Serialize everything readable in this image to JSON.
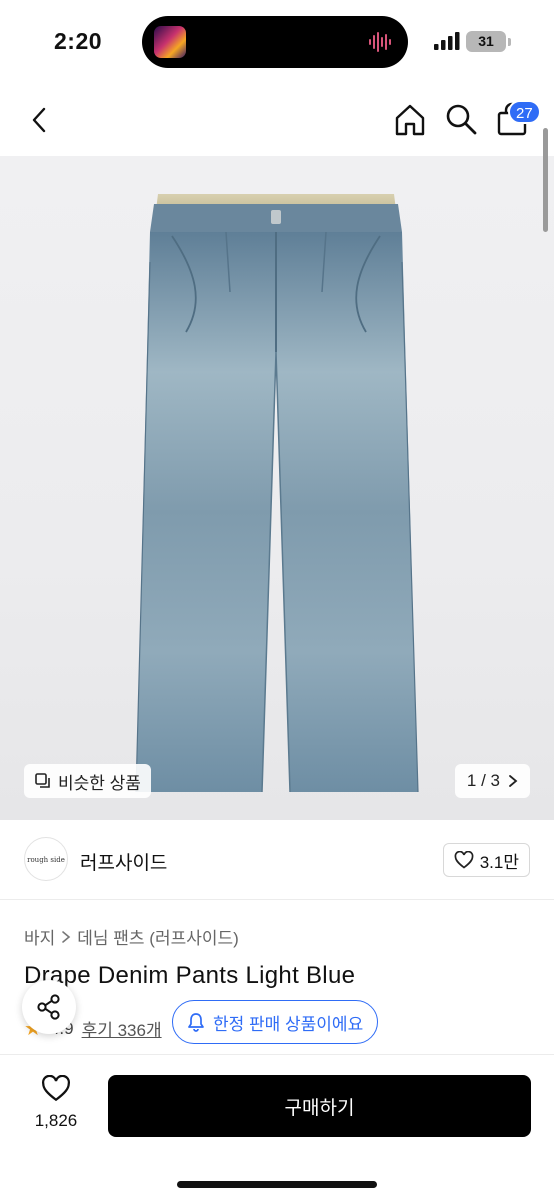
{
  "status_bar": {
    "time": "2:20",
    "battery_level": "31"
  },
  "nav": {
    "cart_count": "27"
  },
  "gallery": {
    "similar_label": "비슷한 상품",
    "pager": "1 / 3"
  },
  "brand": {
    "logo_text": "rough side",
    "name": "러프사이드",
    "likes": "3.1만"
  },
  "product": {
    "breadcrumb": [
      "바지",
      "데님 팬츠 (러프사이드)"
    ],
    "title": "Drape Denim Pants Light Blue",
    "rating": "4.9",
    "reviews": "후기 336개",
    "limited_notice": "한정 판매 상품이에요"
  },
  "bottom": {
    "wish_count": "1,826",
    "buy_label": "구매하기"
  },
  "colors": {
    "accent_blue": "#2f6cf6",
    "star": "#f5a623",
    "buy_bg": "#000000"
  }
}
